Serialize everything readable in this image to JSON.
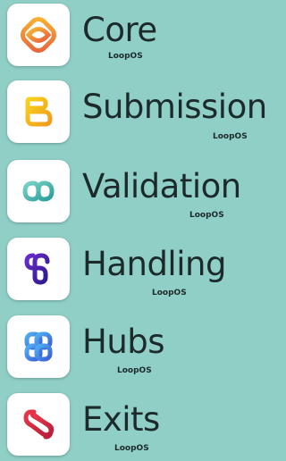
{
  "background": "#8fcfc6",
  "apps": [
    {
      "name": "Core",
      "brand": "LoopOS",
      "icon": "core-loop-icon",
      "color": "#f0a030"
    },
    {
      "name": "Submission",
      "brand": "LoopOS",
      "icon": "submission-loop-icon",
      "color": "#f4bf1c"
    },
    {
      "name": "Validation",
      "brand": "LoopOS",
      "icon": "validation-loop-icon",
      "color": "#3aa8a0"
    },
    {
      "name": "Handling",
      "brand": "LoopOS",
      "icon": "handling-loop-icon",
      "color": "#4b2aa8"
    },
    {
      "name": "Hubs",
      "brand": "LoopOS",
      "icon": "hubs-loop-icon",
      "color": "#3f7fe0"
    },
    {
      "name": "Exits",
      "brand": "LoopOS",
      "icon": "exits-loop-icon",
      "color": "#d42a3a"
    }
  ]
}
